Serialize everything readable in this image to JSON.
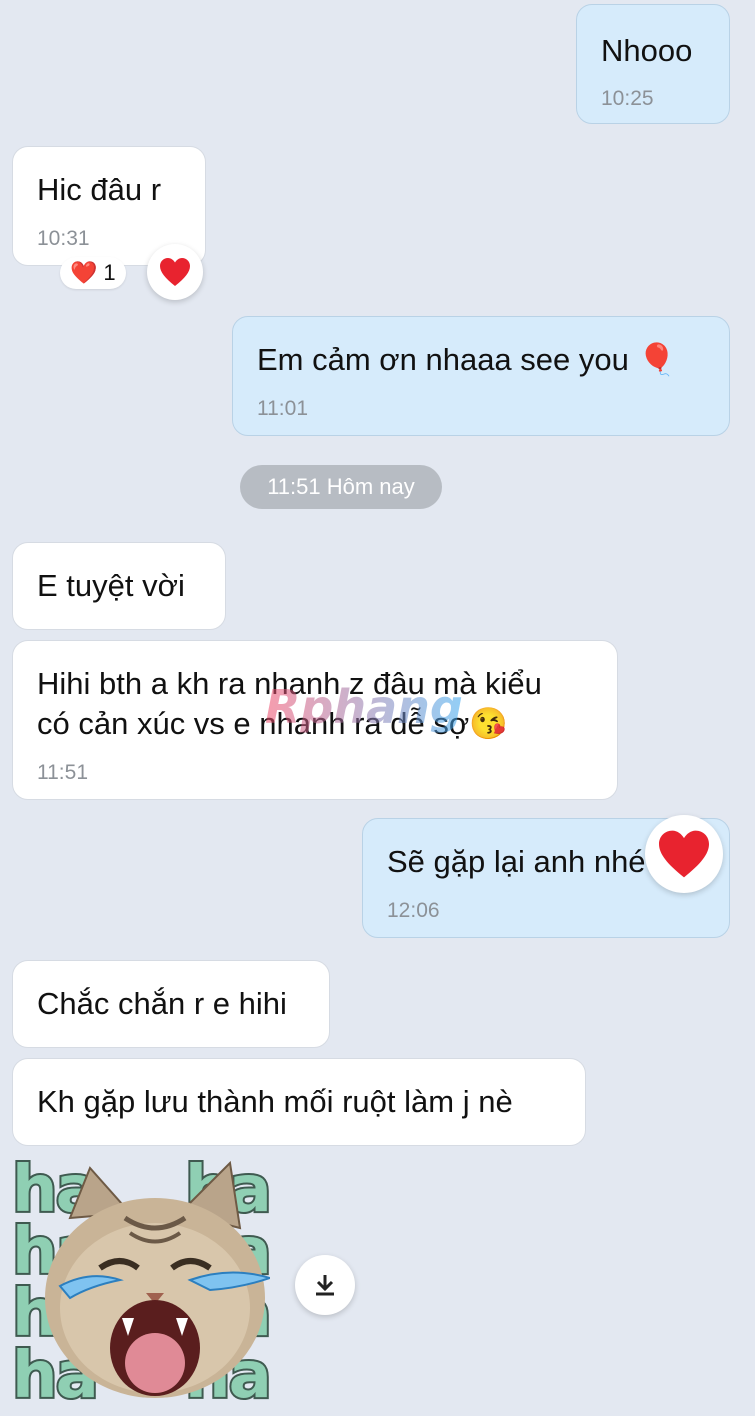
{
  "messages": [
    {
      "id": "m1",
      "direction": "out",
      "text": "Nhooo",
      "time": "10:25"
    },
    {
      "id": "m2",
      "direction": "in",
      "text": "Hic đâu r",
      "time": "10:31",
      "reaction": {
        "emoji": "❤️",
        "count": "1"
      }
    },
    {
      "id": "m3",
      "direction": "out",
      "text": "Em cảm ơn nhaaa see you 🎈",
      "time": "11:01"
    },
    {
      "id": "m4",
      "direction": "in",
      "text": "E tuyệt vời"
    },
    {
      "id": "m5",
      "direction": "in",
      "text_line1": "Hihi bth a kh ra nhanh z đâu mà kiểu",
      "text_line2": "có cản xúc vs e nhanh ra dễ sợ😘",
      "time": "11:51"
    },
    {
      "id": "m6",
      "direction": "out",
      "text": "Sẽ gặp lại anh nhé",
      "time": "12:06"
    },
    {
      "id": "m7",
      "direction": "in",
      "text": "Chắc chắn r e hihi"
    },
    {
      "id": "m8",
      "direction": "in",
      "text": "Kh gặp lưu thành mối ruột làm j nè"
    }
  ],
  "date_separator": "11:51 Hôm nay",
  "sticker": {
    "word": "ha",
    "name": "laughing-cat-sticker"
  },
  "watermark": "Rphang",
  "icons": {
    "heart": "heart-icon",
    "download": "download-icon"
  },
  "colors": {
    "incoming": "#ffffff",
    "outgoing": "#d6ebfb",
    "background": "#e3e8f1",
    "heart": "#e8232f"
  }
}
